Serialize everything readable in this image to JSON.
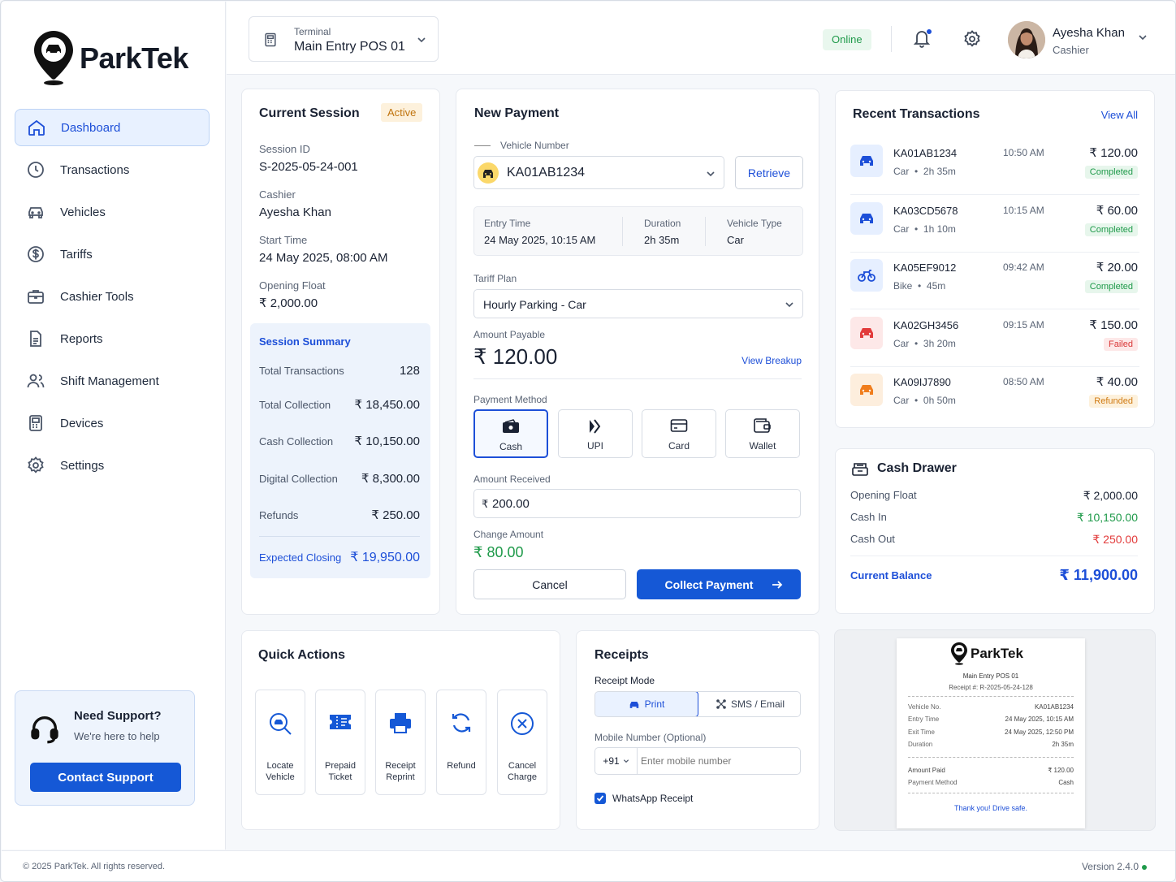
{
  "brand": {
    "name": "ParkTek"
  },
  "nav": {
    "items": [
      {
        "label": "Dashboard"
      },
      {
        "label": "Transactions"
      },
      {
        "label": "Vehicles"
      },
      {
        "label": "Tariffs"
      },
      {
        "label": "Cashier Tools"
      },
      {
        "label": "Reports"
      },
      {
        "label": "Shift Management"
      },
      {
        "label": "Devices"
      },
      {
        "label": "Settings"
      }
    ],
    "active": "Dashboard"
  },
  "support": {
    "title": "Need Support?",
    "subtitle": "We're here to help",
    "button": "Contact Support"
  },
  "header": {
    "terminal_label": "Terminal",
    "terminal_value": "Main Entry POS 01",
    "status": "Online",
    "user_name": "Ayesha Khan",
    "user_role": "Cashier"
  },
  "session": {
    "title": "Current Session",
    "status": "Active",
    "id_label": "Session ID",
    "id_value": "S-2025-05-24-001",
    "cashier_label": "Cashier",
    "cashier_value": "Ayesha Khan",
    "start_label": "Start Time",
    "start_value": "24 May 2025, 08:00 AM",
    "float_label": "Opening Float",
    "float_value": "₹ 2,000.00",
    "summary": {
      "title": "Session Summary",
      "rows": [
        {
          "k": "Total Transactions",
          "v": "128"
        },
        {
          "k": "Total Collection",
          "v": "₹ 18,450.00"
        },
        {
          "k": "Cash Collection",
          "v": "₹ 10,150.00"
        },
        {
          "k": "Digital Collection",
          "v": "₹ 8,300.00"
        },
        {
          "k": "Refunds",
          "v": "₹ 250.00"
        }
      ],
      "expected_label": "Expected Closing",
      "expected_value": "₹ 19,950.00"
    }
  },
  "payment": {
    "title": "New Payment",
    "vehicle_label": "Vehicle Number",
    "vehicle_value": "KA01AB1234",
    "retrieve": "Retrieve",
    "entry_label": "Entry Time",
    "entry_value": "24 May 2025, 10:15 AM",
    "duration_label": "Duration",
    "duration_value": "2h 35m",
    "type_label": "Vehicle Type",
    "type_value": "Car",
    "tariff_label": "Tariff Plan",
    "tariff_value": "Hourly Parking - Car",
    "payable_label": "Amount Payable",
    "payable_value": "₹ 120.00",
    "breakup": "View Breakup",
    "method_label": "Payment Method",
    "methods": [
      "Cash",
      "UPI",
      "Card",
      "Wallet"
    ],
    "selected_method": "Cash",
    "received_label": "Amount Received",
    "received_prefix": "₹",
    "received_value": "200.00",
    "change_label": "Change Amount",
    "change_value": "₹ 80.00",
    "cancel": "Cancel",
    "collect": "Collect Payment"
  },
  "recent": {
    "title": "Recent Transactions",
    "view_all": "View All",
    "items": [
      {
        "no": "KA01AB1234",
        "type": "Car",
        "dur": "2h 35m",
        "time": "10:50 AM",
        "amount": "₹ 120.00",
        "status": "Completed",
        "color": "#1d4fd8"
      },
      {
        "no": "KA03CD5678",
        "type": "Car",
        "dur": "1h 10m",
        "time": "10:15 AM",
        "amount": "₹ 60.00",
        "status": "Completed",
        "color": "#1d4fd8"
      },
      {
        "no": "KA05EF9012",
        "type": "Bike",
        "dur": "45m",
        "time": "09:42 AM",
        "amount": "₹ 20.00",
        "status": "Completed",
        "color": "#1d4fd8"
      },
      {
        "no": "KA02GH3456",
        "type": "Car",
        "dur": "3h 20m",
        "time": "09:15 AM",
        "amount": "₹ 150.00",
        "status": "Failed",
        "color": "#e23b3b"
      },
      {
        "no": "KA09IJ7890",
        "type": "Car",
        "dur": "0h 50m",
        "time": "08:50 AM",
        "amount": "₹ 40.00",
        "status": "Refunded",
        "color": "#f07d1c"
      }
    ],
    "sep": "•"
  },
  "drawer": {
    "title": "Cash Drawer",
    "rows": [
      {
        "k": "Opening Float",
        "v": "₹ 2,000.00"
      },
      {
        "k": "Cash In",
        "v": "₹ 10,150.00"
      },
      {
        "k": "Cash Out",
        "v": "₹ 250.00"
      }
    ],
    "balance_label": "Current Balance",
    "balance_value": "₹ 11,900.00"
  },
  "quick": {
    "title": "Quick Actions",
    "items": [
      {
        "l1": "Locate",
        "l2": "Vehicle"
      },
      {
        "l1": "Prepaid",
        "l2": "Ticket"
      },
      {
        "l1": "Receipt",
        "l2": "Reprint"
      },
      {
        "l1": "Refund",
        "l2": ""
      },
      {
        "l1": "Cancel",
        "l2": "Charge"
      }
    ]
  },
  "receipts": {
    "title": "Receipts",
    "mode_label": "Receipt Mode",
    "mode_print": "Print",
    "mode_sms": "SMS / Email",
    "mobile_label": "Mobile Number (Optional)",
    "country_code": "+91",
    "mobile_placeholder": "Enter mobile number",
    "whatsapp": "WhatsApp Receipt"
  },
  "preview": {
    "brand": "ParkTek",
    "terminal": "Main Entry POS 01",
    "receipt_no": "Receipt #: R-2025-05-24-128",
    "rows": [
      {
        "k": "Vehicle No.",
        "v": "KA01AB1234"
      },
      {
        "k": "Entry Time",
        "v": "24 May 2025, 10:15 AM"
      },
      {
        "k": "Exit Time",
        "v": "24 May 2025, 12:50 PM"
      },
      {
        "k": "Duration",
        "v": "2h 35m"
      }
    ],
    "paid_label": "Amount Paid",
    "paid_value": "₹ 120.00",
    "method_label": "Payment Method",
    "method_value": "Cash",
    "thanks": "Thank you! Drive safe."
  },
  "footer": {
    "copyright": "© 2025 ParkTek. All rights reserved.",
    "version": "Version 2.4.0"
  },
  "colors": {
    "primary": "#1558d6",
    "success": "#1f9a4a",
    "danger": "#e23b3b",
    "warning": "#c0740e"
  }
}
